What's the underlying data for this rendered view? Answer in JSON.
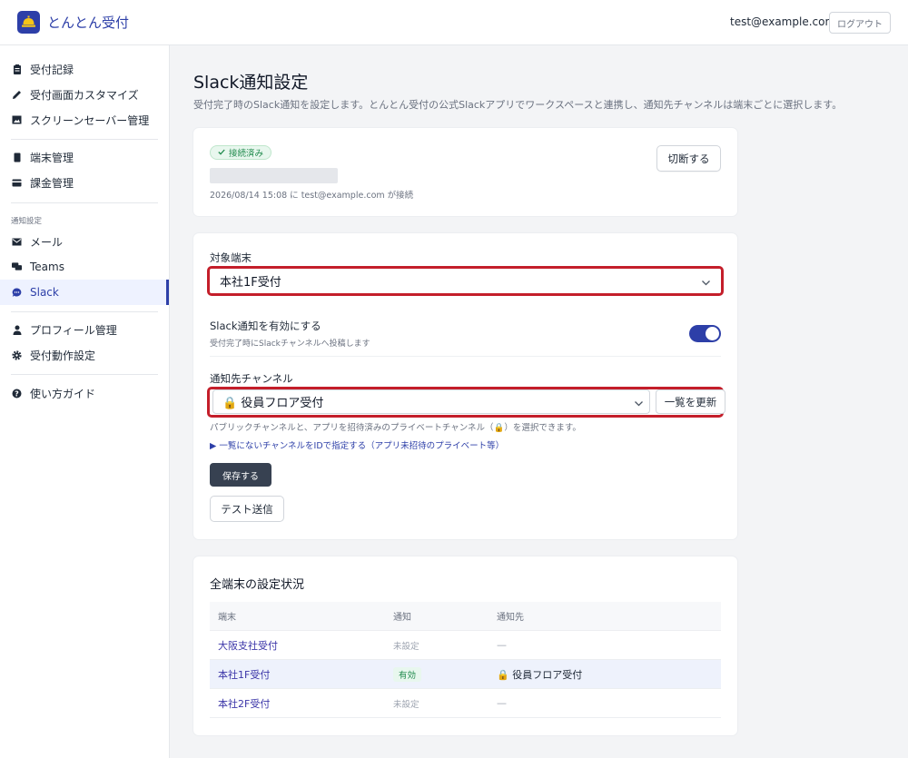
{
  "header": {
    "app_title": "とんとん受付",
    "user_email": "test@example.com",
    "logout_label": "ログアウト"
  },
  "sidebar": {
    "items": [
      {
        "label": "受付記録",
        "icon": "clipboard-icon"
      },
      {
        "label": "受付画面カスタマイズ",
        "icon": "pencil-icon"
      },
      {
        "label": "スクリーンセーバー管理",
        "icon": "image-icon"
      },
      {
        "label": "端末管理",
        "icon": "tablet-icon"
      },
      {
        "label": "課金管理",
        "icon": "credit-card-icon"
      },
      {
        "label": "メール",
        "icon": "mail-icon"
      },
      {
        "label": "Teams",
        "icon": "chat-icon"
      },
      {
        "label": "Slack",
        "icon": "slack-chat-icon"
      },
      {
        "label": "プロフィール管理",
        "icon": "person-icon"
      },
      {
        "label": "受付動作設定",
        "icon": "gear-icon"
      },
      {
        "label": "使い方ガイド",
        "icon": "help-icon"
      }
    ],
    "section_label": "通知設定",
    "active": "Slack"
  },
  "page": {
    "title": "Slack通知設定",
    "description": "受付完了時のSlack通知を設定します。とんとん受付の公式Slackアプリでワークスペースと連携し、通知先チャンネルは端末ごとに選択します。"
  },
  "connection": {
    "status": "接続済み",
    "connected_info": "2026/08/14 15:08 に test@example.com が接続",
    "disconnect_label": "切断する"
  },
  "settings": {
    "device_label": "対象端末",
    "device_value": "本社1F受付",
    "toggle_label": "Slack通知を有効にする",
    "toggle_sub": "受付完了時にSlackチャンネルへ投稿します",
    "toggle_on": true,
    "channel_label": "通知先チャンネル",
    "channel_value": "🔒 役員フロア受付",
    "refresh_label": "一覧を更新",
    "help_text": "パブリックチャンネルと、アプリを招待済みのプライベートチャンネル（🔒）を選択できます。",
    "disclosure_label": "▶ 一覧にないチャンネルをIDで指定する（アプリ未招待のプライベート等）",
    "save_label": "保存する",
    "test_label": "テスト送信"
  },
  "status_table": {
    "title": "全端末の設定状況",
    "headers": [
      "端末",
      "通知",
      "通知先"
    ],
    "rows": [
      {
        "device": "大阪支社受付",
        "notify": "未設定",
        "channel": "—"
      },
      {
        "device": "本社1F受付",
        "notify": "有効",
        "channel": "🔒 役員フロア受付"
      },
      {
        "device": "本社2F受付",
        "notify": "未設定",
        "channel": "—"
      }
    ]
  },
  "colors": {
    "brand": "#2d3fa8",
    "highlight_border": "#c41e2a",
    "success": "#1f8a4c"
  }
}
